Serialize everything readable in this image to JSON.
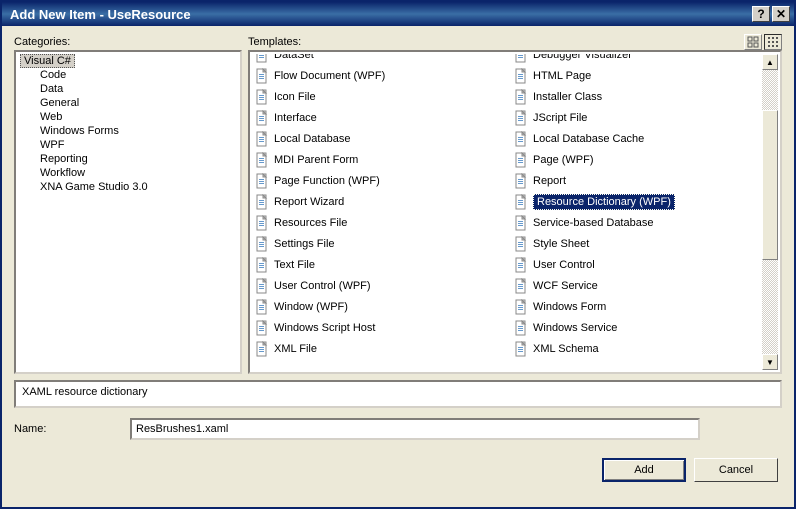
{
  "title": "Add New Item - UseResource",
  "labels": {
    "categories": "Categories:",
    "templates": "Templates:",
    "name": "Name:"
  },
  "categories": {
    "root": "Visual C#",
    "children": [
      "Code",
      "Data",
      "General",
      "Web",
      "Windows Forms",
      "WPF",
      "Reporting",
      "Workflow",
      "XNA Game Studio 3.0"
    ]
  },
  "templates": {
    "col1": [
      "DataSet",
      "Flow Document (WPF)",
      "Icon File",
      "Interface",
      "Local Database",
      "MDI Parent Form",
      "Page Function (WPF)",
      "Report Wizard",
      "Resources File",
      "Settings File",
      "Text File",
      "User Control (WPF)",
      "Window (WPF)",
      "Windows Script Host",
      "XML File"
    ],
    "col2": [
      "Debugger Visualizer",
      "HTML Page",
      "Installer Class",
      "JScript File",
      "Local Database Cache",
      "Page (WPF)",
      "Report",
      "Resource Dictionary (WPF)",
      "Service-based Database",
      "Style Sheet",
      "User Control",
      "WCF Service",
      "Windows Form",
      "Windows Service",
      "XML Schema"
    ],
    "selected": "Resource Dictionary (WPF)"
  },
  "description": "XAML resource dictionary",
  "name_value": "ResBrushes1.xaml",
  "buttons": {
    "add": "Add",
    "cancel": "Cancel"
  }
}
